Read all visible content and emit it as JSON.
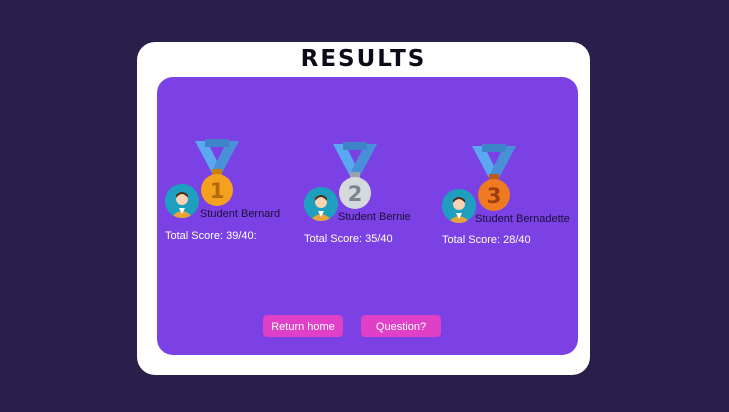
{
  "title": "RESULTS",
  "colors": {
    "background": "#2a1f4a",
    "card": "#ffffff",
    "panel": "#7b41e4",
    "button": "#e040c8",
    "ribbon": "#5aa8f0",
    "gold": "#f4a21d",
    "silver": "#d5d9de",
    "bronze": "#f07a22"
  },
  "podium": [
    {
      "rank": "1",
      "medal_icon": "gold-medal-icon",
      "avatar_icon": "student-avatar-icon",
      "name": "Student Bernard",
      "score": "Total Score: 39/40:"
    },
    {
      "rank": "2",
      "medal_icon": "silver-medal-icon",
      "avatar_icon": "student-avatar-icon",
      "name": "Student Bernie",
      "score": "Total Score: 35/40"
    },
    {
      "rank": "3",
      "medal_icon": "bronze-medal-icon",
      "avatar_icon": "student-avatar-icon",
      "name": "Student Bernadette",
      "score": "Total Score: 28/40"
    }
  ],
  "buttons": {
    "return_home": "Return home",
    "question": "Question?"
  }
}
